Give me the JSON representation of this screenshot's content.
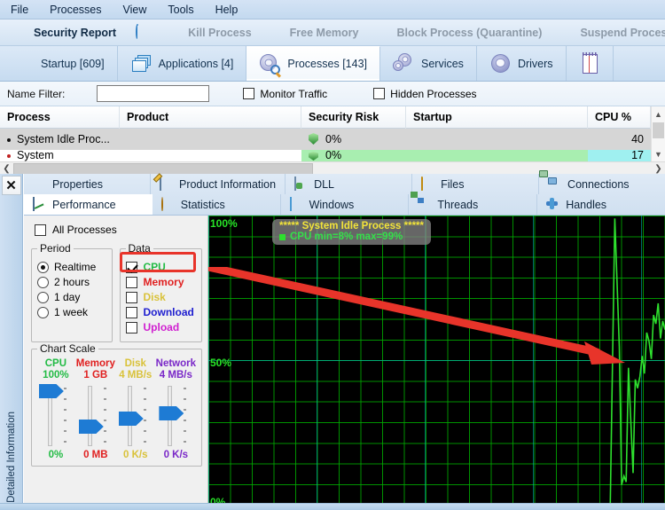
{
  "menu": {
    "items": [
      "File",
      "Processes",
      "View",
      "Tools",
      "Help"
    ]
  },
  "action_toolbar": {
    "items": [
      {
        "label": "Security Report",
        "icon": "shield-icon",
        "enabled": true
      },
      {
        "label": "",
        "icon": "refresh-icon",
        "enabled": true
      },
      {
        "label": "Kill Process",
        "icon": "kill-process-icon",
        "enabled": false
      },
      {
        "label": "Free Memory",
        "icon": "free-memory-icon",
        "enabled": false
      },
      {
        "label": "Block Process (Quarantine)",
        "icon": "block-process-icon",
        "enabled": false
      },
      {
        "label": "Suspend Process",
        "icon": "suspend-process-icon",
        "enabled": false
      }
    ]
  },
  "main_tabs": [
    {
      "label": "Startup [609]",
      "icon": "startup-arrow-icon",
      "active": false
    },
    {
      "label": "Applications [4]",
      "icon": "windows-stack-icon",
      "active": false
    },
    {
      "label": "Processes [143]",
      "icon": "gear-magnifier-icon",
      "active": true
    },
    {
      "label": "Services",
      "icon": "gears-icon",
      "active": false
    },
    {
      "label": "Drivers",
      "icon": "gear-icon",
      "active": false
    },
    {
      "label": "",
      "icon": "notepad-icon",
      "active": false
    }
  ],
  "filter_bar": {
    "name_filter_label": "Name Filter:",
    "name_filter_value": "",
    "name_filter_placeholder": "",
    "monitor_traffic": {
      "label": "Monitor Traffic",
      "checked": false
    },
    "hidden_processes": {
      "label": "Hidden Processes",
      "checked": false
    }
  },
  "process_table": {
    "columns": [
      "Process",
      "Product",
      "Security Risk",
      "Startup",
      "CPU %"
    ],
    "rows": [
      {
        "process": "System Idle Proc...",
        "product": "",
        "security_risk": "0%",
        "startup": "",
        "cpu": "40",
        "selected": true
      },
      {
        "process": "System",
        "product": "",
        "security_risk": "0%",
        "startup": "",
        "cpu": "17",
        "selected": false
      }
    ]
  },
  "detail_panel": {
    "side_label": "Detailed Information",
    "close_label": "✕",
    "tabs_row1": [
      {
        "label": "Properties",
        "icon": "shield-green-icon",
        "active": false
      },
      {
        "label": "Product Information",
        "icon": "product-info-icon",
        "active": false
      },
      {
        "label": "DLL",
        "icon": "dll-icon",
        "active": false
      },
      {
        "label": "Files",
        "icon": "folder-icon",
        "active": false
      },
      {
        "label": "Connections",
        "icon": "connections-icon",
        "active": false
      }
    ],
    "tabs_row2": [
      {
        "label": "Performance",
        "icon": "performance-chart-icon",
        "active": true
      },
      {
        "label": "Statistics",
        "icon": "statistics-icon",
        "active": false
      },
      {
        "label": "Windows",
        "icon": "window-icon",
        "active": false
      },
      {
        "label": "Threads",
        "icon": "threads-icon",
        "active": false
      },
      {
        "label": "Handles",
        "icon": "handles-icon",
        "active": false
      }
    ]
  },
  "controls": {
    "all_processes": {
      "label": "All Processes",
      "checked": false
    },
    "period": {
      "legend": "Period",
      "options": [
        {
          "label": "Realtime",
          "selected": true
        },
        {
          "label": "2 hours",
          "selected": false
        },
        {
          "label": "1 day",
          "selected": false
        },
        {
          "label": "1 week",
          "selected": false
        }
      ]
    },
    "data": {
      "legend": "Data",
      "options": [
        {
          "label": "CPU",
          "checked": true,
          "color": "#22bb44",
          "highlighted": true
        },
        {
          "label": "Memory",
          "checked": false,
          "color": "#e02020",
          "highlighted": false
        },
        {
          "label": "Disk",
          "checked": false,
          "color": "#d9c23a",
          "highlighted": false
        },
        {
          "label": "Download",
          "checked": false,
          "color": "#2020d0",
          "highlighted": false
        },
        {
          "label": "Upload",
          "checked": false,
          "color": "#d020d0",
          "highlighted": false
        }
      ]
    },
    "chart_scale": {
      "legend": "Chart Scale",
      "sliders": [
        {
          "name": "CPU",
          "max": "100%",
          "min": "0%",
          "color": "#22bb44",
          "thumb_pos": 0
        },
        {
          "name": "Memory",
          "max": "1 GB",
          "min": "0 MB",
          "color": "#e02020",
          "thumb_pos": 54
        },
        {
          "name": "Disk",
          "max": "4 MB/s",
          "min": "0 K/s",
          "color": "#d9c23a",
          "thumb_pos": 42
        },
        {
          "name": "Network",
          "max": "4 MB/s",
          "min": "0 K/s",
          "color": "#7a28c8",
          "thumb_pos": 34
        }
      ]
    }
  },
  "chart_data": {
    "type": "line",
    "title": "***** System Idle Process *****",
    "legend_entries": [
      {
        "name": "CPU",
        "text": "CPU min=8% max=99%",
        "color": "#2ee02e"
      }
    ],
    "ylabel": "",
    "xlabel": "",
    "ylim": [
      0,
      100
    ],
    "ytick_labels": [
      "100%",
      "50%",
      "0%"
    ],
    "ytick_values": [
      100,
      50,
      0
    ],
    "grid": true,
    "background": "#000000",
    "grid_color": "#00aa00",
    "legend_position": "top-left",
    "series": [
      {
        "name": "CPU",
        "color": "#2ee02e",
        "comment": "flat/no-data across most of window; activity only in final ~12% of x range",
        "x": [
          0,
          86,
          87,
          88,
          89,
          90,
          90.5,
          91,
          91.5,
          92,
          92.5,
          93,
          93.5,
          94,
          94.5,
          95,
          95.5,
          96,
          96.5,
          97,
          97.5,
          98,
          98.5,
          99,
          99.5,
          100
        ],
        "y": [
          0,
          0,
          0,
          0,
          99,
          55,
          8,
          11,
          9,
          48,
          30,
          12,
          44,
          41,
          45,
          52,
          46,
          60,
          57,
          51,
          66,
          63,
          70,
          58,
          64,
          61
        ]
      }
    ],
    "annotations": [
      {
        "type": "arrow",
        "color": "#e8342a",
        "from_x": 0,
        "from_y": 78,
        "to_x": 92,
        "to_y": 46,
        "points_to": "cpu-chart-activity"
      },
      {
        "type": "highlight-rect",
        "color": "#e8342a",
        "target": "data-cpu-checkbox"
      }
    ]
  }
}
